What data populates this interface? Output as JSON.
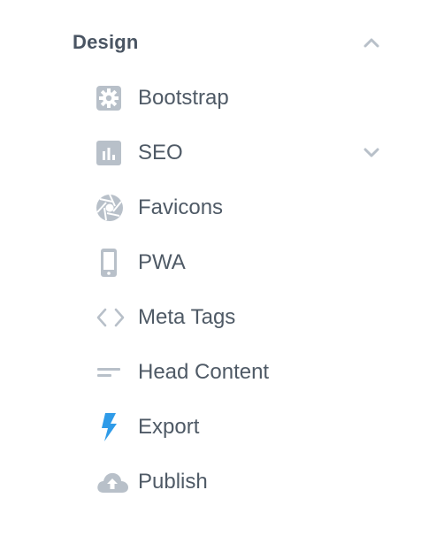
{
  "section": {
    "title": "Design",
    "expanded": true
  },
  "items": [
    {
      "label": "Bootstrap",
      "icon": "gear-icon"
    },
    {
      "label": "SEO",
      "icon": "bar-chart-icon",
      "has_children": true
    },
    {
      "label": "Favicons",
      "icon": "aperture-icon"
    },
    {
      "label": "PWA",
      "icon": "mobile-phone-icon"
    },
    {
      "label": "Meta Tags",
      "icon": "code-brackets-icon"
    },
    {
      "label": "Head Content",
      "icon": "lines-icon"
    },
    {
      "label": "Export",
      "icon": "lightning-bolt-icon"
    },
    {
      "label": "Publish",
      "icon": "cloud-upload-icon"
    }
  ],
  "colors": {
    "icon_gray": "#b8c0c9",
    "text": "#4f5a66",
    "title": "#4a5563",
    "accent_blue": "#2f9be8"
  }
}
